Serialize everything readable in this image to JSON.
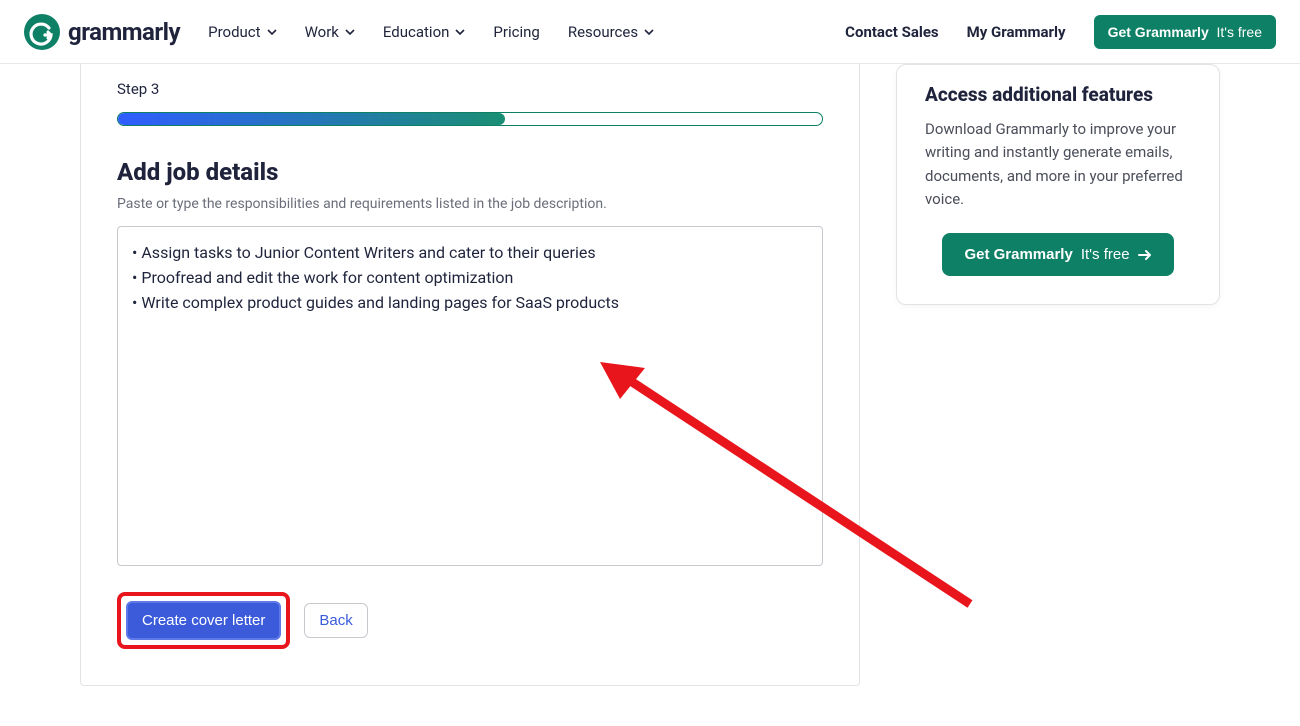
{
  "nav": {
    "logo_text": "grammarly",
    "items": [
      {
        "label": "Product",
        "has_chevron": true
      },
      {
        "label": "Work",
        "has_chevron": true
      },
      {
        "label": "Education",
        "has_chevron": true
      },
      {
        "label": "Pricing",
        "has_chevron": false
      },
      {
        "label": "Resources",
        "has_chevron": true
      }
    ],
    "contact_sales": "Contact Sales",
    "my_grammarly": "My Grammarly",
    "cta_bold": "Get Grammarly",
    "cta_thin": "It's free"
  },
  "main": {
    "step_label": "Step 3",
    "progress_pct": 55,
    "title": "Add job details",
    "subtitle": "Paste or type the responsibilities and requirements listed in the job description.",
    "textarea_value": "• Assign tasks to Junior Content Writers and cater to their queries\n• Proofread and edit the work for content optimization\n• Write complex product guides and landing pages for SaaS products",
    "primary_button": "Create cover letter",
    "back_button": "Back"
  },
  "sidebar": {
    "title": "Access additional features",
    "body": "Download Grammarly to improve your writing and instantly generate emails, documents, and more in your preferred voice.",
    "cta_bold": "Get Grammarly",
    "cta_thin": "It's free"
  }
}
